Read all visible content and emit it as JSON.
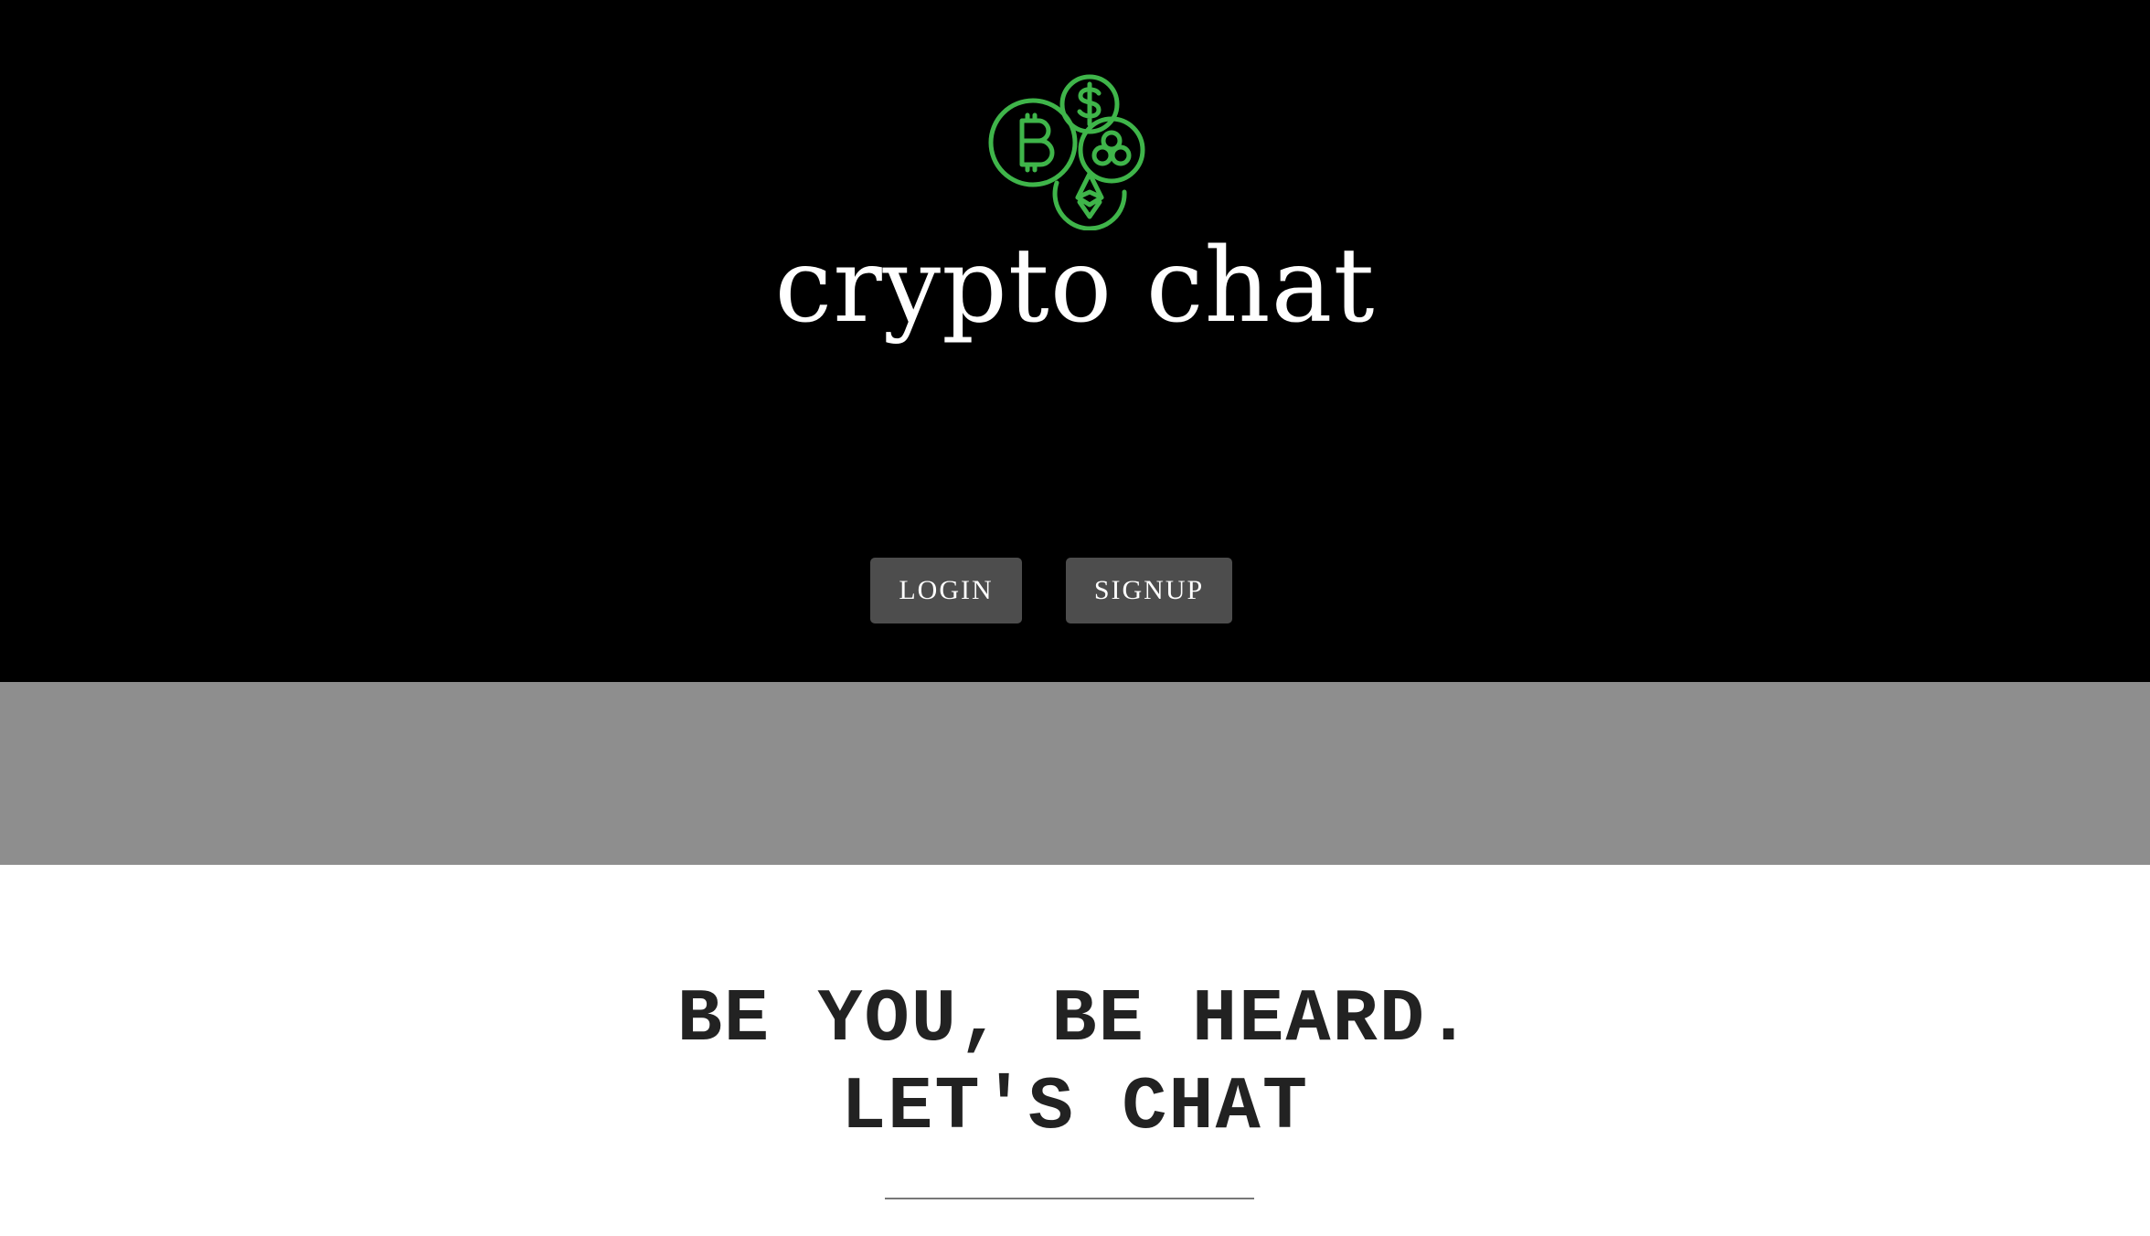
{
  "brand": {
    "logo_icon": "crypto-coins-logo-icon",
    "name": "crypto chat",
    "accent_color": "#3fb54a"
  },
  "auth": {
    "login_label": "LOGIN",
    "signup_label": "SIGNUP"
  },
  "tagline": {
    "line1": "BE YOU, BE HEARD.",
    "line2": "LET'S CHAT"
  }
}
